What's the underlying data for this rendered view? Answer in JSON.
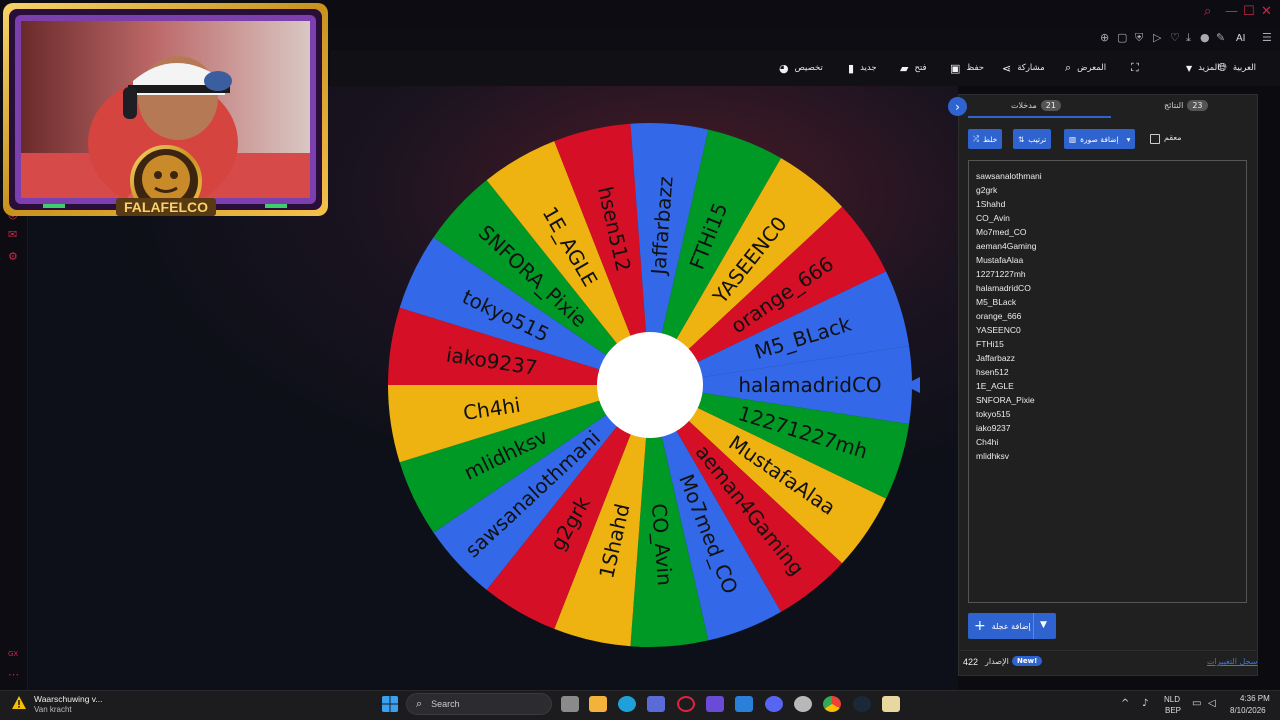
{
  "browser": {
    "ai_label": "AI",
    "window_controls": [
      "search",
      "minimize",
      "maximize",
      "close"
    ]
  },
  "toolbar": {
    "items": [
      {
        "label": "العربية",
        "icon": "globe-icon"
      },
      {
        "label": "المزيد",
        "icon": "caret-down-icon"
      },
      {
        "label": "",
        "icon": "fullscreen-icon"
      },
      {
        "label": "المعرض",
        "icon": "search-icon"
      },
      {
        "label": "مشاركة",
        "icon": "share-icon"
      },
      {
        "label": "حفظ",
        "icon": "save-icon"
      },
      {
        "label": "فتح",
        "icon": "folder-icon"
      },
      {
        "label": "جديد",
        "icon": "file-icon"
      },
      {
        "label": "تخصيص",
        "icon": "palette-icon"
      }
    ]
  },
  "wheel": {
    "entries": [
      "halamadridCO",
      "12271227mh",
      "MustafaAlaa",
      "aeman4Gaming",
      "Mo7med_CO",
      "CO_Avin",
      "1Shahd",
      "g2grk",
      "sawsanalothmani",
      "mlidhksv",
      "Ch4hi",
      "iako9237",
      "tokyo515",
      "SNFORA_Pixie",
      "1E_AGLE",
      "hsen512",
      "Jaffarbazz",
      "FTHi15",
      "YASEENC0",
      "orange_666",
      "M5_BLack"
    ],
    "colors": [
      "#3369e8",
      "#009925",
      "#eeb211",
      "#d50f25"
    ],
    "pointer_color": "#3369e8"
  },
  "panel": {
    "tabs": [
      {
        "label": "مدخلات",
        "count": "21",
        "active": true
      },
      {
        "label": "النتائج",
        "count": "23",
        "active": false
      }
    ],
    "buttons": {
      "shuffle": "خلط",
      "sort": "ترتيب",
      "add_image": "إضافة صورة"
    },
    "advanced_label": "معقم",
    "entries": [
      "sawsanalothmani",
      "g2grk",
      "1Shahd",
      "CO_Avin",
      "Mo7med_CO",
      "aeman4Gaming",
      "MustafaAlaa",
      "12271227mh",
      "halamadridCO",
      "M5_BLack",
      "orange_666",
      "YASEENC0",
      "FTHi15",
      "Jaffarbazz",
      "hsen512",
      "1E_AGLE",
      "SNFORA_Pixie",
      "tokyo515",
      "iako9237",
      "Ch4hi",
      "mlidhksv"
    ],
    "add_wheel_label": "إضافة عجلة",
    "version_label": "الإصدار",
    "version_number": "422",
    "new_badge": "New!",
    "changelog_link": "سجل التغييرات"
  },
  "webcam": {
    "logo_text": "FALAFELCO"
  },
  "taskbar": {
    "warning_title": "Waarschuwing v...",
    "warning_subtitle": "Van kracht",
    "search_placeholder": "Search",
    "lang_top": "NLD",
    "lang_bottom": "BEP",
    "time": "4:36 PM",
    "date": "8/10/2026"
  }
}
